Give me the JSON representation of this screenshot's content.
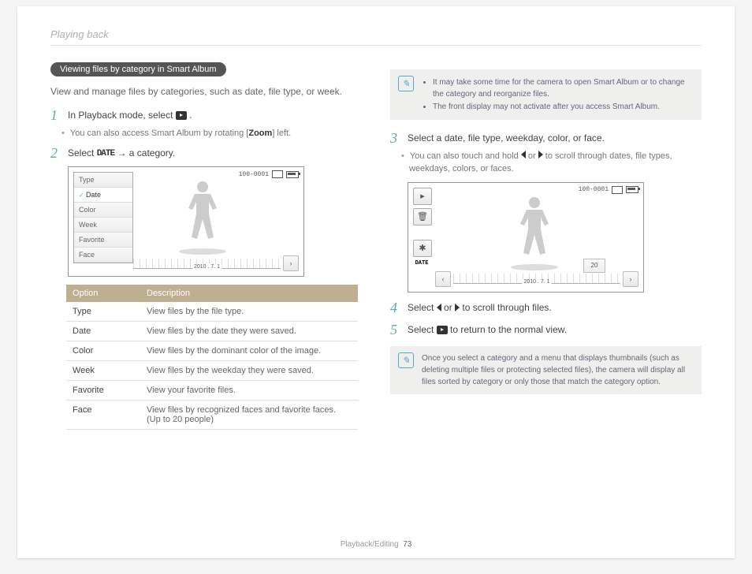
{
  "header": "Playing back",
  "footer_section": "Playback/Editing",
  "footer_page": "73",
  "left": {
    "pill": "Viewing files by category in Smart Album",
    "intro": "View and manage files by categories, such as date, file type, or week.",
    "step1_pre": "In Playback mode, select ",
    "step1_post": ".",
    "step1_sub_pre": "You can also access Smart Album by rotating [",
    "step1_sub_bold": "Zoom",
    "step1_sub_post": "] left.",
    "step2_pre": "Select ",
    "step2_date": "DATE",
    "step2_post": " → a category.",
    "menu": {
      "items": [
        "Type",
        "Date",
        "Color",
        "Week",
        "Favorite",
        "Face"
      ]
    },
    "screen_counter": "100-0001",
    "timeline_date": "2010 . 7. 1",
    "table": {
      "h1": "Option",
      "h2": "Description",
      "rows": [
        {
          "opt": "Type",
          "desc": "View files by the file type."
        },
        {
          "opt": "Date",
          "desc": "View files by the date they were saved."
        },
        {
          "opt": "Color",
          "desc": "View files by the dominant color of the image."
        },
        {
          "opt": "Week",
          "desc": "View files by the weekday they were saved."
        },
        {
          "opt": "Favorite",
          "desc": "View your favorite files."
        },
        {
          "opt": "Face",
          "desc": "View files by recognized faces and favorite faces. (Up to 20 people)"
        }
      ]
    }
  },
  "right": {
    "note1": {
      "b1": "It may take some time for the camera to open Smart Album or to change the category and reorganize files.",
      "b2": "The front display may not activate after you access Smart Album."
    },
    "step3": "Select a date, file type, weekday, color, or face.",
    "step3_sub_pre": "You can also touch and hold ",
    "step3_sub_mid": " or ",
    "step3_sub_post": " to scroll through dates, file types, weekdays, colors, or faces.",
    "screen_counter": "100-0001",
    "side_date": "DATE",
    "timeline_date": "2010 . 7. 1",
    "thumb_count": "20",
    "step4_pre": "Select ",
    "step4_mid": " or ",
    "step4_post": " to scroll through files.",
    "step5_pre": "Select ",
    "step5_post": " to return to the normal view.",
    "note2": "Once you select a category and a menu that displays thumbnails (such as deleting multiple files or protecting selected files), the camera will display all files sorted by category or only those that match the category option."
  }
}
